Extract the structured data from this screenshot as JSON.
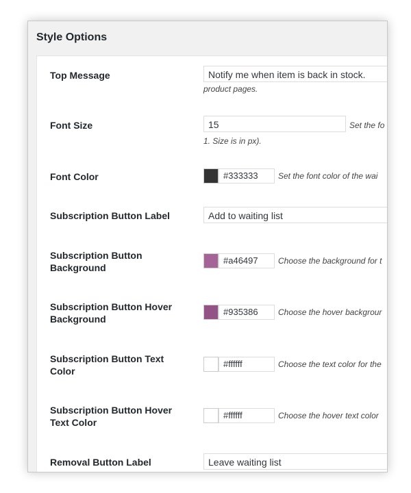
{
  "section_title": "Style Options",
  "fields": {
    "top_message": {
      "label": "Top Message",
      "value": "Notify me when item is back in stock.",
      "description": "product pages."
    },
    "font_size": {
      "label": "Font Size",
      "value": "15",
      "side_description": "Set the fo",
      "description": "1. Size is in px)."
    },
    "font_color": {
      "label": "Font Color",
      "value": "#333333",
      "color": "#333333",
      "description": "Set the font color of the wai"
    },
    "subscription_button_label": {
      "label": "Subscription Button Label",
      "value": "Add to waiting list"
    },
    "subscription_button_background": {
      "label": "Subscription Button Background",
      "value": "#a46497",
      "color": "#a46497",
      "description": "Choose the background for t"
    },
    "subscription_button_hover_background": {
      "label": "Subscription Button Hover Background",
      "value": "#935386",
      "color": "#935386",
      "description": "Choose the hover backgrour"
    },
    "subscription_button_text_color": {
      "label": "Subscription Button Text Color",
      "value": "#ffffff",
      "color": "#ffffff",
      "description": "Choose the text color for the"
    },
    "subscription_button_hover_text_color": {
      "label": "Subscription Button Hover Text Color",
      "value": "#ffffff",
      "color": "#ffffff",
      "description": "Choose the hover text color"
    },
    "removal_button_label": {
      "label": "Removal Button Label",
      "value": "Leave waiting list"
    }
  }
}
